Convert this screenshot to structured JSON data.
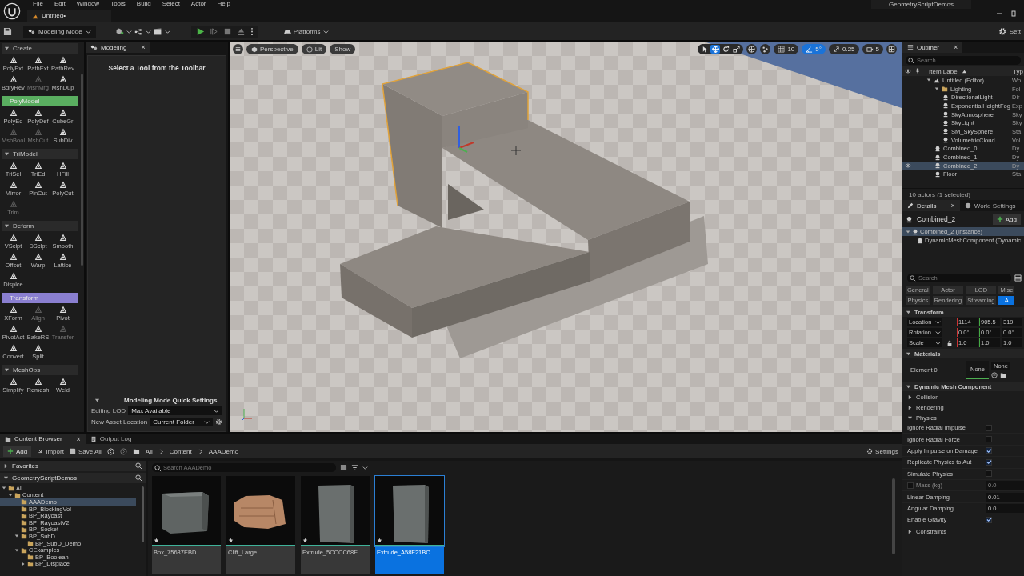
{
  "menu": [
    "File",
    "Edit",
    "Window",
    "Tools",
    "Build",
    "Select",
    "Actor",
    "Help"
  ],
  "project_name": "GeometryScriptDemos",
  "document_tab": "Untitled•",
  "toolbar": {
    "mode": "Modeling Mode",
    "platforms": "Platforms",
    "settings": "Sett"
  },
  "tool_palette": {
    "sections": [
      {
        "title": "Create",
        "tools": [
          {
            "label": "PolyExt",
            "disabled": false
          },
          {
            "label": "PathExt",
            "disabled": false
          },
          {
            "label": "PathRev",
            "disabled": false
          },
          {
            "label": "BdryRev",
            "disabled": false
          },
          {
            "label": "MshMrg",
            "disabled": true
          },
          {
            "label": "MshDup",
            "disabled": false
          }
        ]
      },
      {
        "title": "PolyModel",
        "color": "#5aae60",
        "tools": [
          {
            "label": "PolyEd",
            "disabled": false
          },
          {
            "label": "PolyDef",
            "disabled": false
          },
          {
            "label": "CubeGr",
            "disabled": false
          },
          {
            "label": "MshBool",
            "disabled": true
          },
          {
            "label": "MshCut",
            "disabled": true
          },
          {
            "label": "SubDiv",
            "disabled": false
          }
        ]
      },
      {
        "title": "TriModel",
        "tools": [
          {
            "label": "TriSel",
            "disabled": false
          },
          {
            "label": "TriEd",
            "disabled": false
          },
          {
            "label": "HFill",
            "disabled": false
          },
          {
            "label": "Mirror",
            "disabled": false
          },
          {
            "label": "PlnCut",
            "disabled": false
          },
          {
            "label": "PolyCut",
            "disabled": false
          },
          {
            "label": "Trim",
            "disabled": true
          }
        ]
      },
      {
        "title": "Deform",
        "tools": [
          {
            "label": "VSclpt",
            "disabled": false
          },
          {
            "label": "DSclpt",
            "disabled": false
          },
          {
            "label": "Smooth",
            "disabled": false
          },
          {
            "label": "Offset",
            "disabled": false
          },
          {
            "label": "Warp",
            "disabled": false
          },
          {
            "label": "Lattice",
            "disabled": false
          },
          {
            "label": "Displce",
            "disabled": false
          }
        ]
      },
      {
        "title": "Transform",
        "color": "#8a7fd0",
        "tools": [
          {
            "label": "XForm",
            "disabled": false
          },
          {
            "label": "Align",
            "disabled": true
          },
          {
            "label": "Pivot",
            "disabled": false
          },
          {
            "label": "PivotAct",
            "disabled": false
          },
          {
            "label": "BakeRS",
            "disabled": false
          },
          {
            "label": "Transfer",
            "disabled": true
          },
          {
            "label": "Convert",
            "disabled": false
          },
          {
            "label": "Split",
            "disabled": false
          }
        ]
      },
      {
        "title": "MeshOps",
        "tools": [
          {
            "label": "Simplify",
            "disabled": false
          },
          {
            "label": "Remesh",
            "disabled": false
          },
          {
            "label": "Weld",
            "disabled": false
          }
        ]
      }
    ]
  },
  "modeling_panel": {
    "tab": "Modeling",
    "close": "×",
    "prompt": "Select a Tool from the Toolbar",
    "quick_settings_title": "Modeling Mode Quick Settings",
    "fields": [
      {
        "label": "Editing LOD",
        "value": "Max Available"
      },
      {
        "label": "New Asset Location",
        "value": "Current Folder"
      }
    ]
  },
  "viewport": {
    "view_mode": "Perspective",
    "lighting": "Lit",
    "show": "Show",
    "tools": [
      {
        "kind": "select",
        "selected": false
      },
      {
        "kind": "move",
        "selected": true
      },
      {
        "kind": "rotate",
        "selected": false
      },
      {
        "kind": "scale",
        "selected": false
      }
    ],
    "grid_snap": {
      "value": "10",
      "on": false
    },
    "rotation_snap": {
      "value": "5°",
      "on": true
    },
    "scale_snap": {
      "value": "0.25",
      "on": false
    },
    "camera_speed": "5"
  },
  "outliner": {
    "tab": "Outliner",
    "close": "×",
    "search_placeholder": "Search",
    "columns": [
      "Item Label",
      "Typ"
    ],
    "items": [
      {
        "label": "Untitled (Editor)",
        "type": "Wo",
        "kind": "world",
        "selected": false,
        "expanded": true,
        "children": [
          {
            "label": "Lighting",
            "type": "Fol",
            "kind": "folder",
            "selected": false,
            "expanded": true,
            "children": [
              {
                "label": "DirectionalLight",
                "type": "Dir",
                "kind": "actor",
                "selected": false
              },
              {
                "label": "ExponentialHeightFog",
                "type": "Exp",
                "kind": "actor",
                "selected": false
              },
              {
                "label": "SkyAtmosphere",
                "type": "Sky",
                "kind": "actor",
                "selected": false
              },
              {
                "label": "SkyLight",
                "type": "Sky",
                "kind": "actor",
                "selected": false
              },
              {
                "label": "SM_SkySphere",
                "type": "Sta",
                "kind": "actor",
                "selected": false
              },
              {
                "label": "VolumetricCloud",
                "type": "Vol",
                "kind": "actor",
                "selected": false
              }
            ]
          },
          {
            "label": "Combined_0",
            "type": "Dy",
            "kind": "actor",
            "selected": false
          },
          {
            "label": "Combined_1",
            "type": "Dy",
            "kind": "actor",
            "selected": false
          },
          {
            "label": "Combined_2",
            "type": "Dy",
            "kind": "actor",
            "selected": true
          },
          {
            "label": "Floor",
            "type": "Sta",
            "kind": "actor",
            "selected": false
          }
        ]
      }
    ],
    "footer": "10 actors (1 selected)"
  },
  "details": {
    "tabs": [
      {
        "label": "Details",
        "close": "×",
        "selected": true
      },
      {
        "label": "World Settings",
        "selected": false
      }
    ],
    "actor": "Combined_2",
    "add": "Add",
    "components": [
      {
        "label": "Combined_2 (Instance)",
        "selected": true,
        "expanded": true,
        "children": [
          {
            "label": "DynamicMeshComponent (Dynamic",
            "selected": false
          }
        ]
      }
    ],
    "search_placeholder": "Search",
    "filters": [
      {
        "label": "General",
        "selected": false
      },
      {
        "label": "Actor",
        "selected": false
      },
      {
        "label": "LOD",
        "selected": false
      },
      {
        "label": "Misc",
        "selected": false
      },
      {
        "label": "Physics",
        "selected": false
      },
      {
        "label": "Rendering",
        "selected": false
      },
      {
        "label": "Streaming",
        "selected": false
      },
      {
        "label": "A",
        "selected": true
      }
    ],
    "sections": [
      {
        "kind": "transform",
        "title": "Transform",
        "expanded": true,
        "rows": [
          {
            "label": "Location",
            "values": [
              "1114",
              "905.5",
              "319."
            ],
            "lock": false
          },
          {
            "label": "Rotation",
            "values": [
              "0.0°",
              "0.0°",
              "0.0°"
            ],
            "lock": false
          },
          {
            "label": "Scale",
            "values": [
              "1.0",
              "1.0",
              "1.0"
            ],
            "lock": true
          }
        ]
      },
      {
        "kind": "materials",
        "title": "Materials",
        "expanded": true,
        "element": "Element 0",
        "thumbnail": "None",
        "value": "None"
      },
      {
        "kind": "header",
        "title": "Dynamic Mesh Component",
        "expanded": true
      },
      {
        "kind": "group",
        "title": "Collision",
        "expanded": false
      },
      {
        "kind": "group",
        "title": "Rendering",
        "expanded": false
      },
      {
        "kind": "group",
        "title": "Physics",
        "expanded": true,
        "properties": [
          {
            "kind": "checkbox",
            "label": "Ignore Radial Impulse",
            "checked": false,
            "disabled": false
          },
          {
            "kind": "checkbox",
            "label": "Ignore Radial Force",
            "checked": false,
            "disabled": false
          },
          {
            "kind": "checkbox",
            "label": "Apply Impulse on Damage",
            "checked": true,
            "disabled": false
          },
          {
            "kind": "checkbox",
            "label": "Replicate Physics to Aut",
            "checked": true,
            "disabled": false
          },
          {
            "kind": "checkbox",
            "label": "Simulate Physics",
            "checked": false,
            "disabled": false
          },
          {
            "kind": "check_number",
            "label": "Mass (kg)",
            "checked": false,
            "value": "0.0",
            "disabled": true
          },
          {
            "kind": "number",
            "label": "Linear Damping",
            "value": "0.01",
            "disabled": false
          },
          {
            "kind": "number",
            "label": "Angular Damping",
            "value": "0.0",
            "disabled": false
          },
          {
            "kind": "checkbox",
            "label": "Enable Gravity",
            "checked": true,
            "disabled": false
          }
        ]
      },
      {
        "kind": "group",
        "title": "Constraints",
        "expanded": false
      }
    ]
  },
  "content_browser": {
    "tabs": [
      {
        "label": "Content Browser",
        "close": "×",
        "selected": true
      },
      {
        "label": "Output Log",
        "selected": false
      }
    ],
    "add": "Add",
    "import": "Import",
    "save_all": "Save All",
    "path": [
      "All",
      "Content",
      "AAADemo"
    ],
    "settings": "Settings",
    "sources": [
      {
        "title": "Favorites",
        "expanded": false
      },
      {
        "title": "GeometryScriptDemos",
        "expanded": true
      }
    ],
    "folders": [
      {
        "label": "All",
        "selected": false,
        "expanded": true,
        "children": [
          {
            "label": "Content",
            "selected": false,
            "expanded": true,
            "children": [
              {
                "label": "AAADemo",
                "selected": true
              },
              {
                "label": "BP_BlockingVol",
                "selected": false
              },
              {
                "label": "BP_Raycast",
                "selected": false
              },
              {
                "label": "BP_RaycastV2",
                "selected": false
              },
              {
                "label": "BP_Socket",
                "selected": false
              },
              {
                "label": "BP_SubD",
                "selected": false,
                "expanded": true,
                "children": [
                  {
                    "label": "BP_SubD_Demo",
                    "selected": false
                  }
                ]
              },
              {
                "label": "CExamples",
                "selected": false,
                "expanded": true,
                "children": [
                  {
                    "label": "BP_Boolean",
                    "selected": false
                  },
                  {
                    "label": "BP_Displace",
                    "selected": false,
                    "expanded": false
                  }
                ]
              }
            ]
          }
        ]
      }
    ],
    "search_placeholder": "Search AAADemo",
    "assets": [
      {
        "name": "Box_75687EBD",
        "kind": "box",
        "selected": false
      },
      {
        "name": "Cliff_Large",
        "kind": "rock",
        "selected": false
      },
      {
        "name": "Extrude_5CCCC68F",
        "kind": "slab",
        "selected": false
      },
      {
        "name": "Extrude_A58F21BC",
        "kind": "slab",
        "selected": true
      }
    ]
  }
}
